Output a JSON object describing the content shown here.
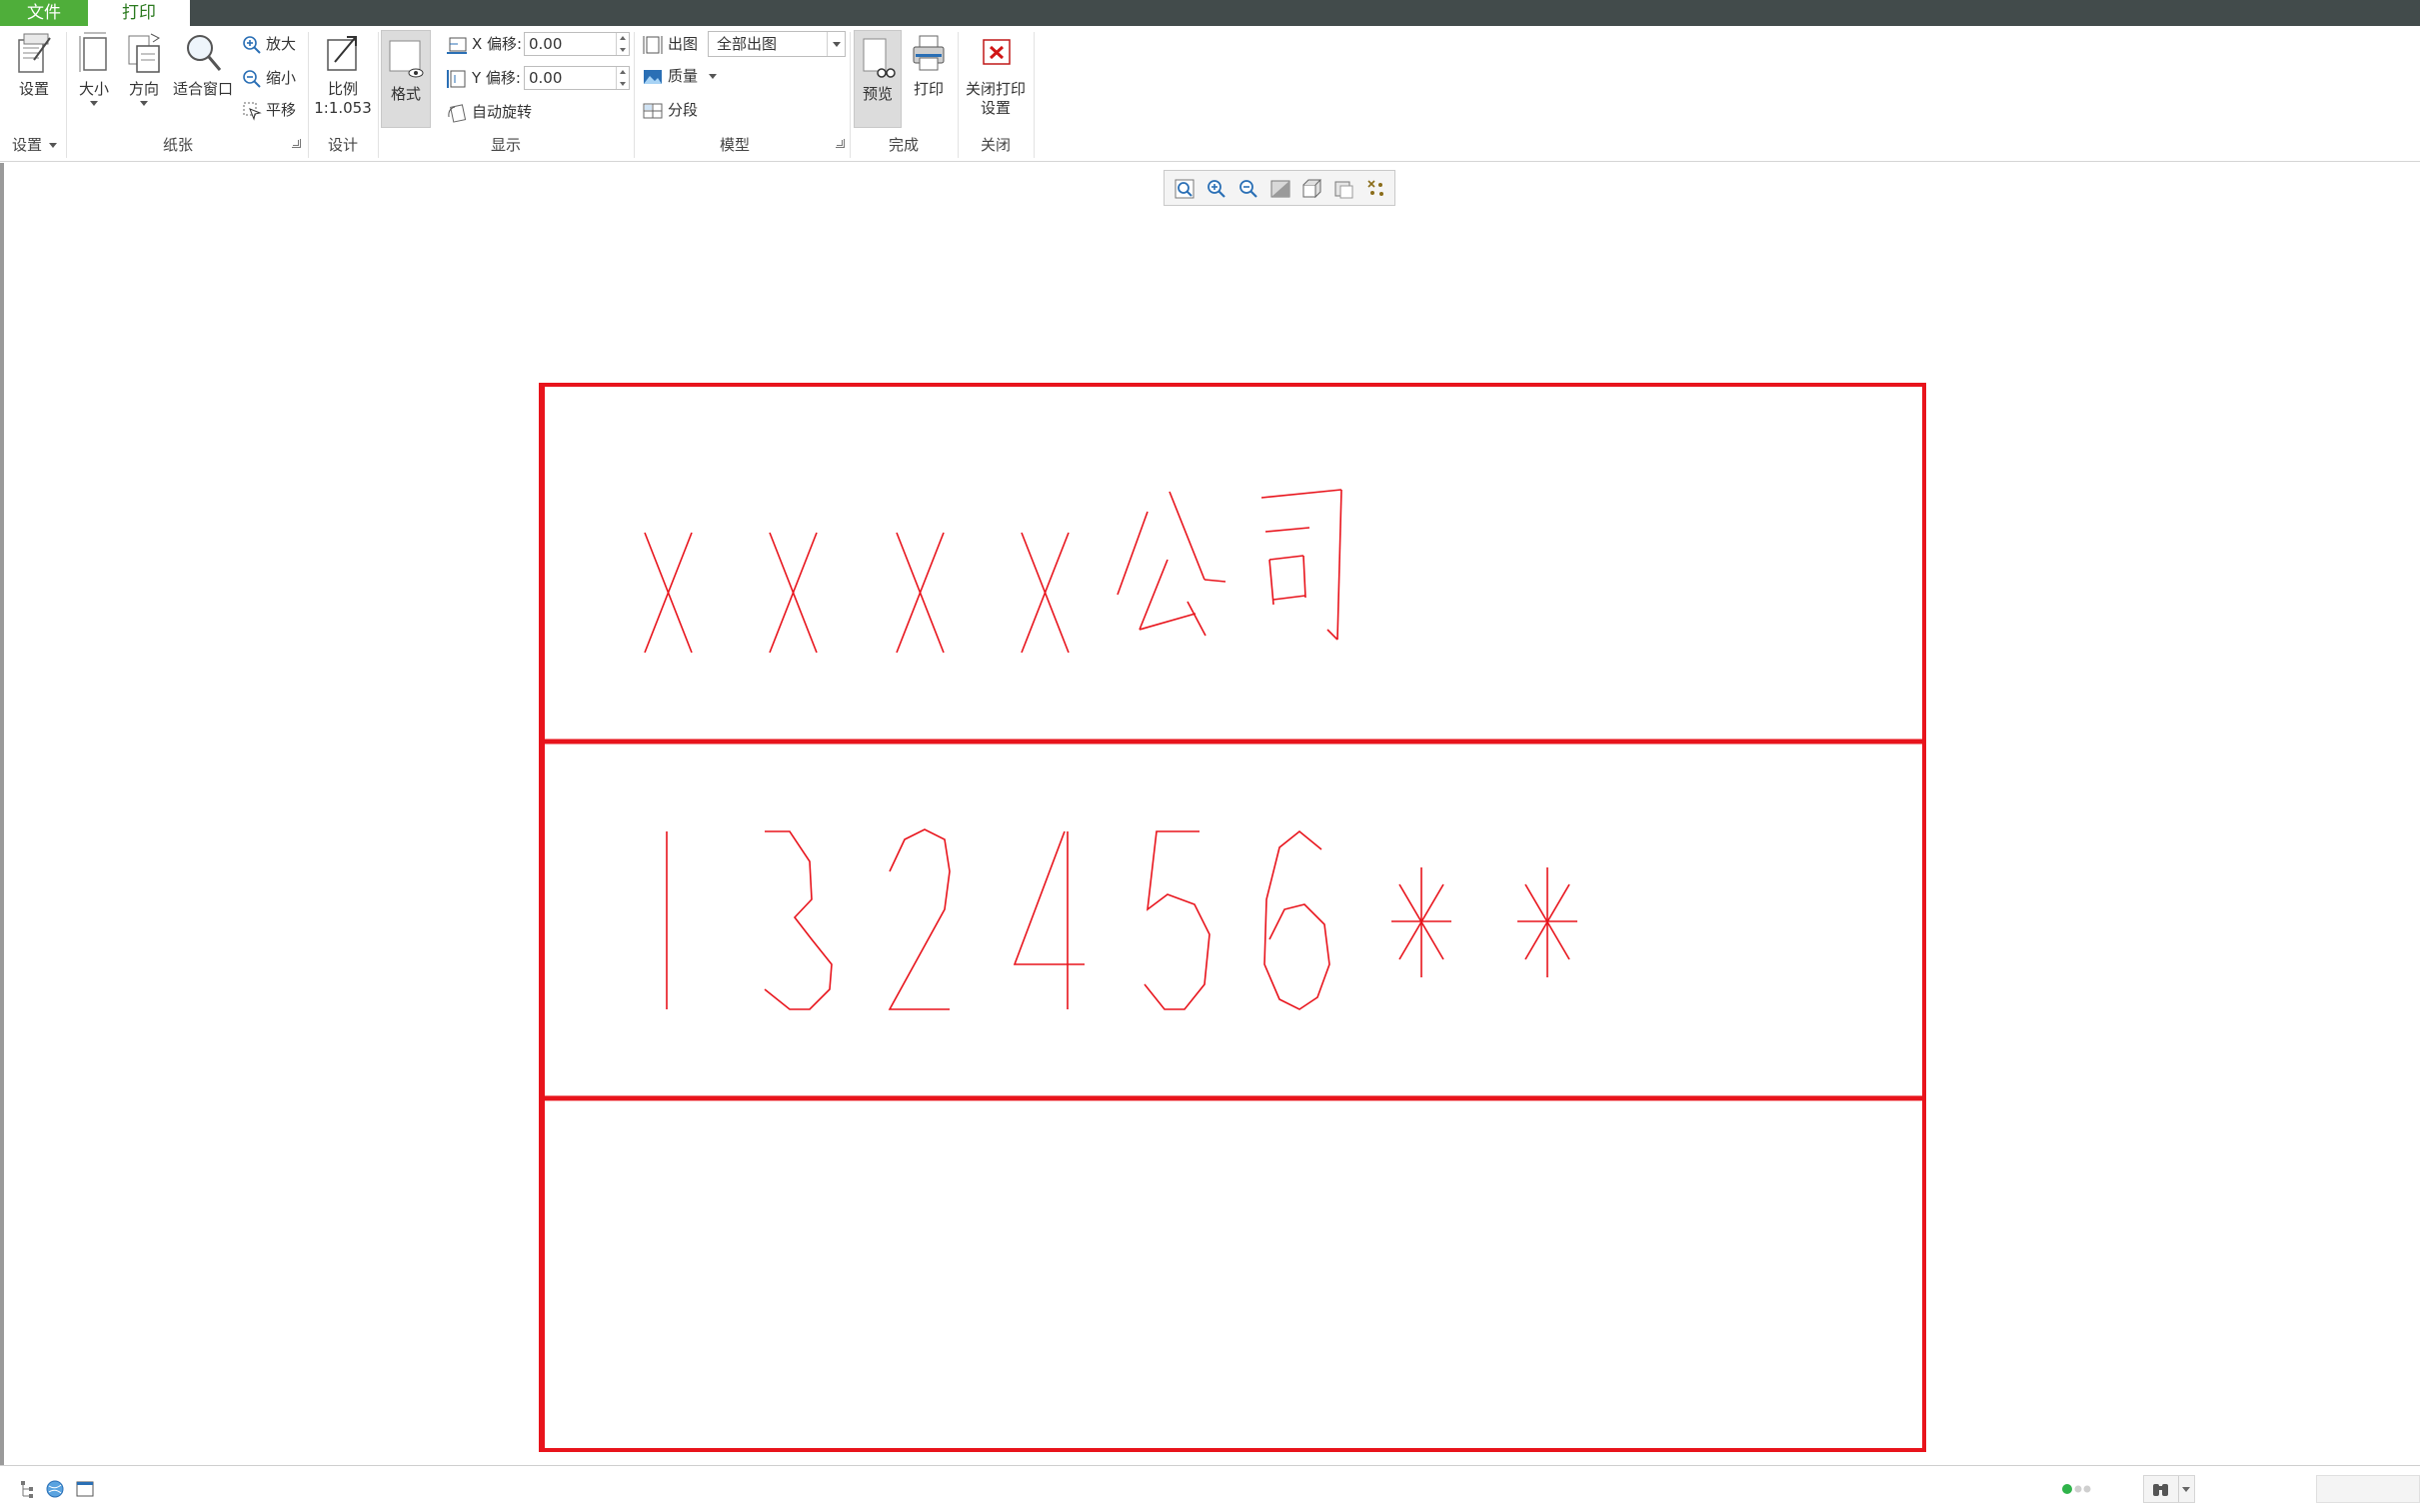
{
  "tabs": [
    {
      "label": "文件"
    },
    {
      "label": "打印"
    }
  ],
  "ribbon": {
    "settings_group": {
      "setup_label": "设置",
      "group_label": "设置"
    },
    "paper_group": {
      "size_label": "大小",
      "orientation_label": "方向",
      "fit_label": "适合窗口",
      "zoom_in_label": "放大",
      "zoom_out_label": "缩小",
      "pan_label": "平移",
      "group_label": "纸张"
    },
    "design_group": {
      "scale_label": "比例",
      "scale_value": "1:1.053",
      "group_label": "设计"
    },
    "display_group": {
      "format_label": "格式",
      "x_offset_label": "X 偏移:",
      "x_offset_value": "0.00",
      "y_offset_label": "Y 偏移:",
      "y_offset_value": "0.00",
      "auto_rotate_label": "自动旋转",
      "group_label": "显示"
    },
    "model_group": {
      "output_label": "出图",
      "output_value": "全部出图",
      "quality_label": "质量",
      "segment_label": "分段",
      "group_label": "模型"
    },
    "finish_group": {
      "preview_label": "预览",
      "print_label": "打印",
      "group_label": "完成"
    },
    "close_group": {
      "close_label_line1": "关闭打印",
      "close_label_line2": "设置",
      "group_label": "关闭"
    }
  },
  "drawing": {
    "frame_color": "#e8141c",
    "row1_text": "XXXX公司",
    "row2_text": "132456**"
  },
  "colors": {
    "accent_green": "#4fae3a",
    "title_bar": "#424b4b",
    "status_green": "#2fb34a"
  }
}
